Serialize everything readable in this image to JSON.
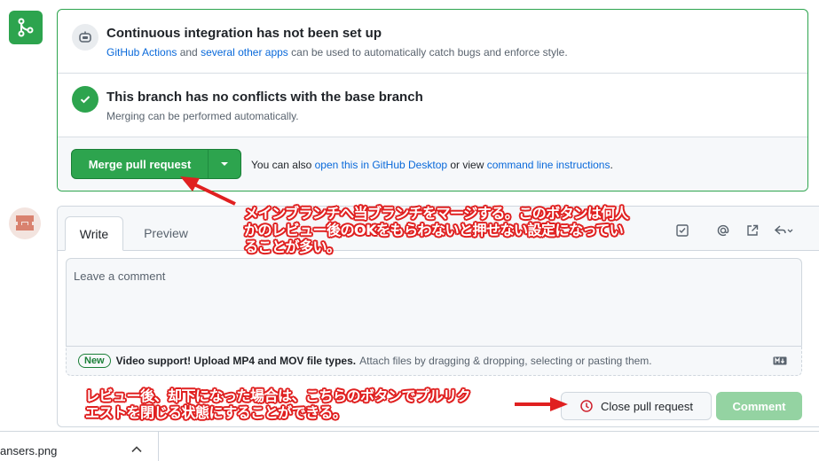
{
  "merge_box": {
    "ci_title": "Continuous integration has not been set up",
    "ci_sub_link1": "GitHub Actions",
    "ci_sub_mid": " and ",
    "ci_sub_link2": "several other apps",
    "ci_sub_end": " can be used to automatically catch bugs and enforce style.",
    "conflict_title": "This branch has no conflicts with the base branch",
    "conflict_sub": "Merging can be performed automatically.",
    "merge_button": "Merge pull request",
    "also_prefix": "You can also ",
    "also_link1": "open this in GitHub Desktop",
    "also_mid": " or view ",
    "also_link2": "command line instructions",
    "also_end": "."
  },
  "comment": {
    "tab_write": "Write",
    "tab_preview": "Preview",
    "placeholder": "Leave a comment",
    "new_badge": "New",
    "attach_strong": "Video support! Upload MP4 and MOV file types.",
    "attach_rest": "Attach files by dragging & dropping, selecting or pasting them.",
    "close_button": "Close pull request",
    "comment_button": "Comment"
  },
  "annotations": {
    "merge_note": "メインブランチへ当ブランチをマージする。このボタンは何人\nかのレビュー後のOKをもらわないと押せない設定になってい\nることが多い。",
    "close_note": "レビュー後、却下になった場合は、こちらのボタンでプルリク\nエストを閉じる状態にすることができる。"
  },
  "download_shelf": {
    "filename": "ansers.png"
  },
  "colors": {
    "success": "#2da44e",
    "link": "#0969da",
    "annotation_red": "#e02020"
  }
}
